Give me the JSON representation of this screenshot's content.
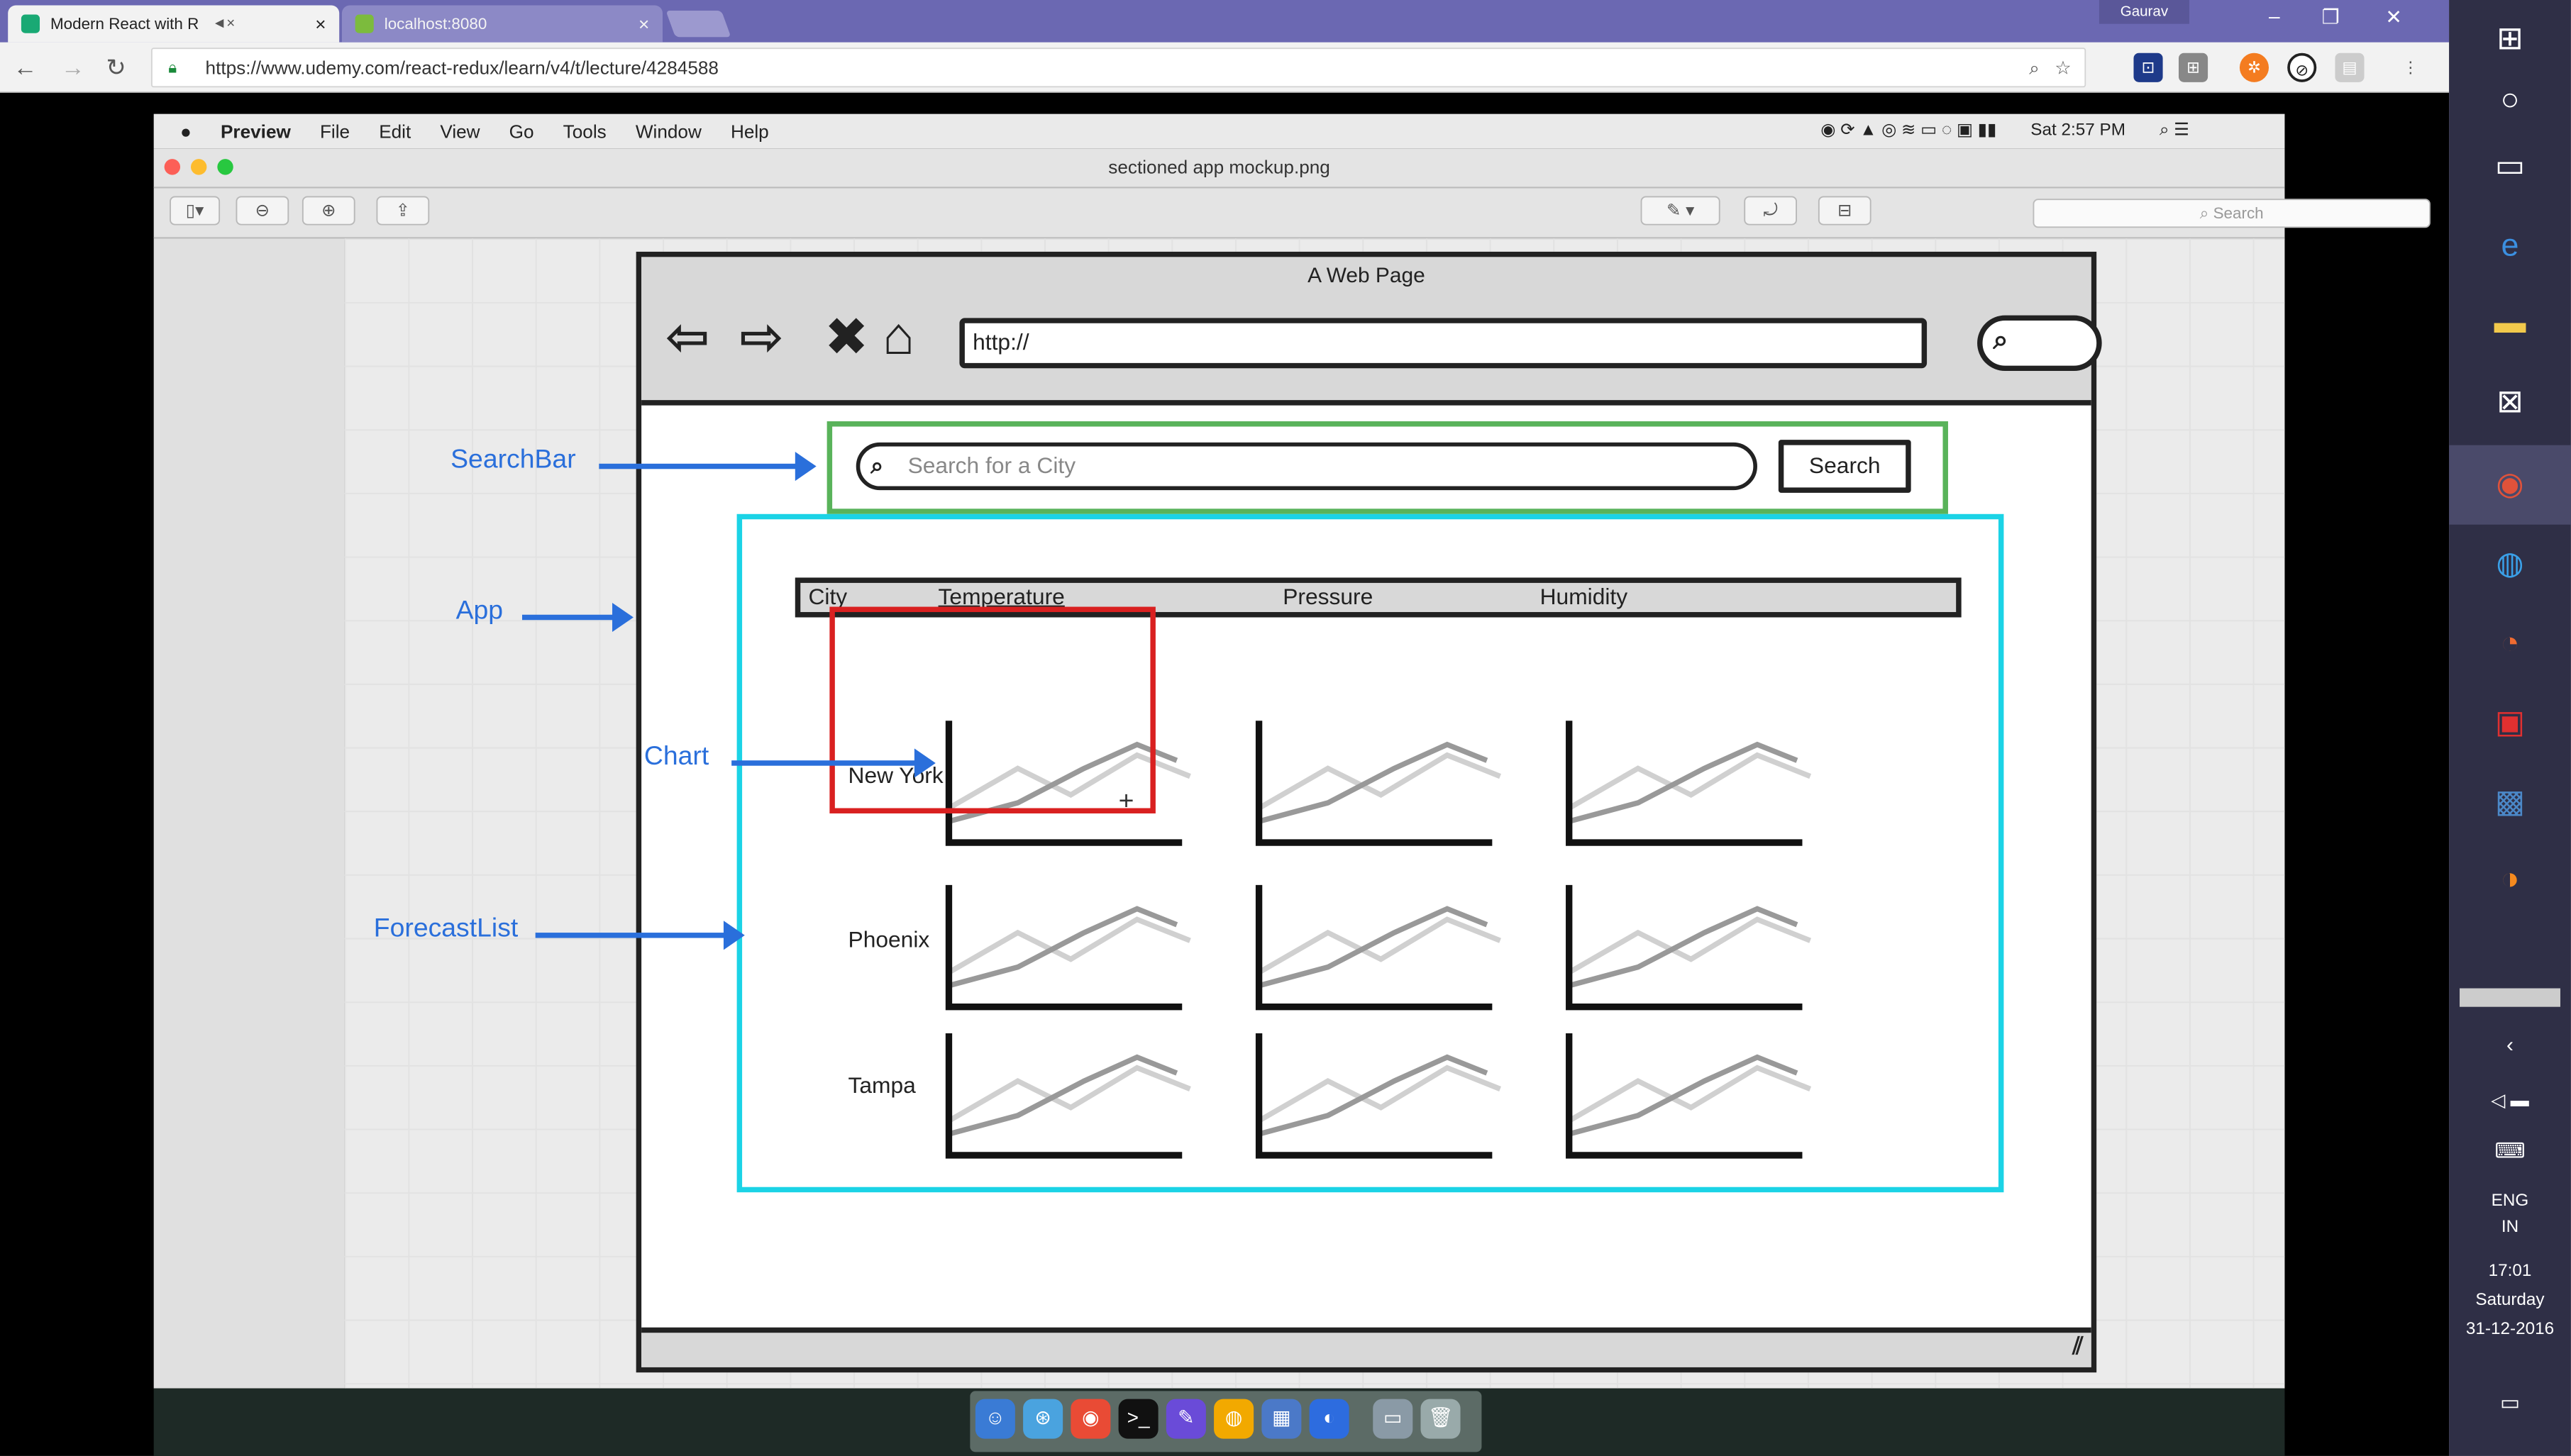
{
  "browser": {
    "tabs": [
      {
        "title": "Modern React with R",
        "favicon_color": "#19a974"
      },
      {
        "title": "localhost:8080",
        "favicon_color": "#7cbb3d"
      }
    ],
    "user": "Gaurav",
    "url": "https://www.udemy.com/react-redux/learn/v4/t/lecture/4284588"
  },
  "mac": {
    "app": "Preview",
    "menu": [
      "File",
      "Edit",
      "View",
      "Go",
      "Tools",
      "Window",
      "Help"
    ],
    "clock": "Sat 2:57 PM",
    "doc_title": "sectioned app mockup.png",
    "search_placeholder": "Search"
  },
  "mockup": {
    "page_title": "A Web Page",
    "url": "http://",
    "search_placeholder": "Search for a City",
    "search_button": "Search",
    "columns": [
      "City",
      "Temperature",
      "Pressure",
      "Humidity"
    ],
    "cities": [
      "New York",
      "Phoenix",
      "Tampa"
    ]
  },
  "annotations": {
    "searchbar": "SearchBar",
    "app": "App",
    "chart": "Chart",
    "forecastlist": "ForecastList"
  },
  "colors": {
    "searchbar_box": "#59b35a",
    "app_box": "#1bd3e6",
    "chart_box": "#d92020",
    "annotation": "#2a6fdb"
  },
  "windows": {
    "language": "ENG",
    "region": "IN",
    "time": "17:01",
    "day": "Saturday",
    "date": "31-12-2016"
  }
}
